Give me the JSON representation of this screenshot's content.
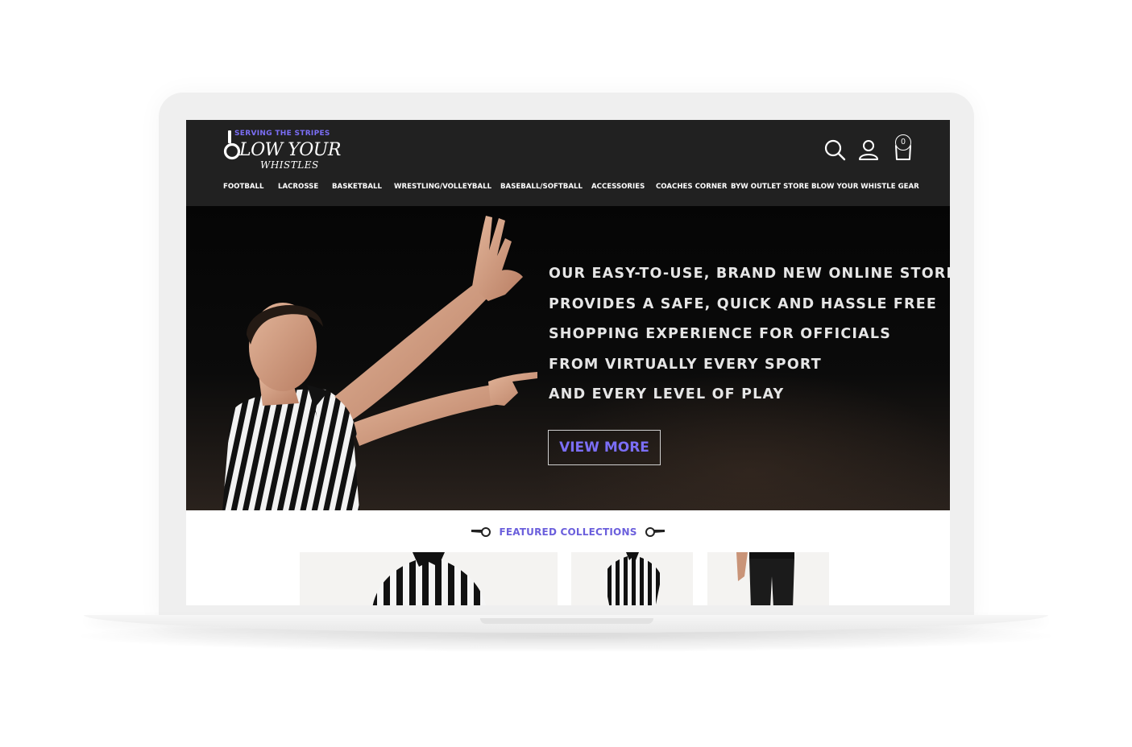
{
  "logo": {
    "tagline": "SERVING THE STRIPES",
    "line1": "LOW YOUR",
    "line2": "WHISTLES"
  },
  "header": {
    "cart_count": "0",
    "icons": [
      "search-icon",
      "account-icon",
      "shopping-bag-icon"
    ]
  },
  "nav": {
    "items": [
      {
        "label": "FOOTBALL"
      },
      {
        "label": "LACROSSE"
      },
      {
        "label": "BASKETBALL"
      },
      {
        "label": "WRESTLING/VOLLEYBALL"
      },
      {
        "label": "BASEBALL/SOFTBALL"
      },
      {
        "label": "ACCESSORIES"
      },
      {
        "label": "COACHES CORNER"
      },
      {
        "label": "BYW OUTLET STORE"
      },
      {
        "label": "BLOW YOUR WHISTLE GEAR"
      }
    ]
  },
  "hero": {
    "lines": [
      "OUR EASY-TO-USE, BRAND NEW ONLINE STORE",
      "PROVIDES A SAFE, QUICK AND HASSLE FREE",
      "SHOPPING EXPERIENCE FOR OFFICIALS",
      "FROM VIRTUALLY EVERY SPORT",
      "AND EVERY LEVEL OF PLAY"
    ],
    "cta_label": "VIEW MORE"
  },
  "featured": {
    "heading": "FEATURED COLLECTIONS"
  },
  "colors": {
    "accent": "#7b6ef6",
    "header_bg": "#212121"
  }
}
